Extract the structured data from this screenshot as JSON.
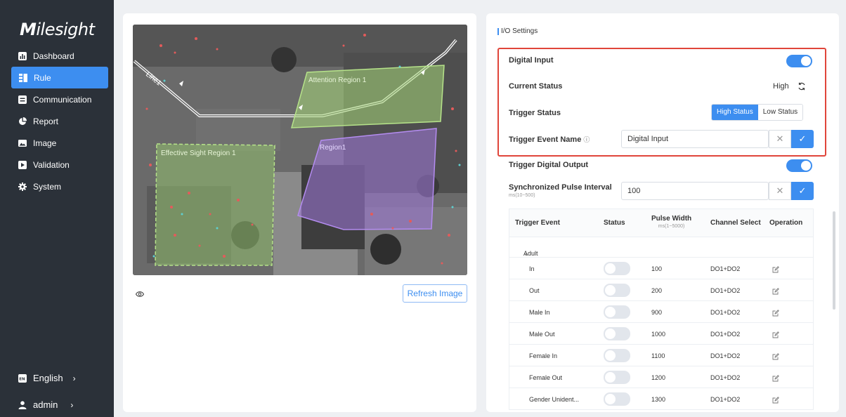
{
  "app": {
    "logo_prefix": "M",
    "logo_rest": "ilesight"
  },
  "sidebar": {
    "items": [
      {
        "label": "Dashboard",
        "icon": "dashboard-icon"
      },
      {
        "label": "Rule",
        "icon": "rule-icon",
        "active": true
      },
      {
        "label": "Communication",
        "icon": "communication-icon"
      },
      {
        "label": "Report",
        "icon": "report-icon"
      },
      {
        "label": "Image",
        "icon": "image-icon"
      },
      {
        "label": "Validation",
        "icon": "validation-icon"
      },
      {
        "label": "System",
        "icon": "gear-icon"
      }
    ],
    "language": "English",
    "user": "admin"
  },
  "preview": {
    "regions": {
      "line": "Line1",
      "attention": "Attention Region 1",
      "effective": "Effective Sight Region 1",
      "region1": "Region1"
    },
    "refresh_label": "Refresh Image"
  },
  "io": {
    "section_title": "I/O Settings",
    "digital_input_label": "Digital Input",
    "digital_input_enabled": true,
    "current_status_label": "Current Status",
    "current_status_value": "High",
    "trigger_status_label": "Trigger Status",
    "trigger_status_options": [
      "High Status",
      "Low Status"
    ],
    "trigger_status_selected": "High Status",
    "trigger_event_name_label": "Trigger Event Name",
    "trigger_event_name_value": "Digital Input",
    "trigger_digital_output_label": "Trigger Digital Output",
    "trigger_digital_output_enabled": true,
    "sync_pulse_label": "Synchronized Pulse Interval",
    "sync_pulse_hint": "ms(10~500)",
    "sync_pulse_value": "100"
  },
  "table": {
    "headers": {
      "event": "Trigger Event",
      "status": "Status",
      "pulse": "Pulse Width",
      "pulse_hint": "ms(1~5000)",
      "channel": "Channel Select",
      "operation": "Operation"
    },
    "group": "Adult",
    "rows": [
      {
        "event": "In",
        "status": false,
        "pulse": "100",
        "channel": "DO1+DO2"
      },
      {
        "event": "Out",
        "status": false,
        "pulse": "200",
        "channel": "DO1+DO2"
      },
      {
        "event": "Male In",
        "status": false,
        "pulse": "900",
        "channel": "DO1+DO2"
      },
      {
        "event": "Male Out",
        "status": false,
        "pulse": "1000",
        "channel": "DO1+DO2"
      },
      {
        "event": "Female In",
        "status": false,
        "pulse": "1100",
        "channel": "DO1+DO2"
      },
      {
        "event": "Female Out",
        "status": false,
        "pulse": "1200",
        "channel": "DO1+DO2"
      },
      {
        "event": "Gender Unident...",
        "status": false,
        "pulse": "1300",
        "channel": "DO1+DO2"
      }
    ]
  },
  "colors": {
    "accent": "#3d8ef0",
    "sidebar": "#2b3139",
    "highlight": "#e0453a"
  }
}
